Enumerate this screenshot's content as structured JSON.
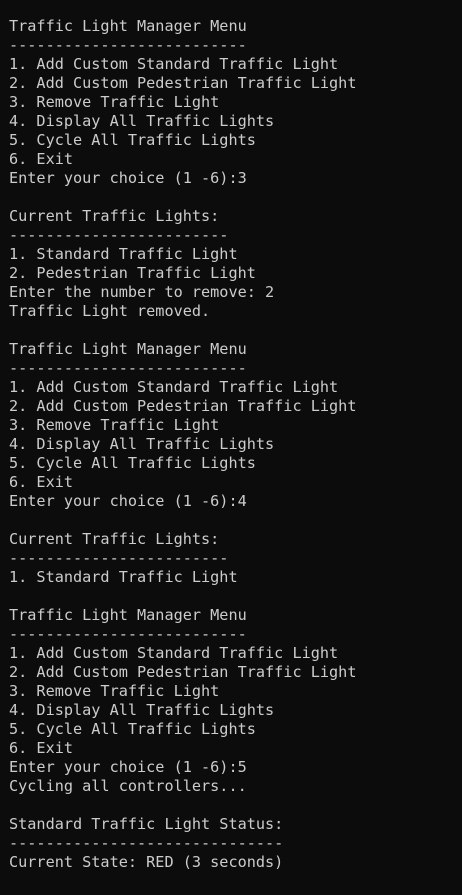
{
  "terminal": {
    "lines": [
      "Traffic Light Manager Menu",
      "--------------------------",
      "1. Add Custom Standard Traffic Light",
      "2. Add Custom Pedestrian Traffic Light",
      "3. Remove Traffic Light",
      "4. Display All Traffic Lights",
      "5. Cycle All Traffic Lights",
      "6. Exit",
      "Enter your choice (1 -6):3",
      "",
      "Current Traffic Lights:",
      "------------------------",
      "1. Standard Traffic Light",
      "2. Pedestrian Traffic Light",
      "Enter the number to remove: 2",
      "Traffic Light removed.",
      "",
      "Traffic Light Manager Menu",
      "--------------------------",
      "1. Add Custom Standard Traffic Light",
      "2. Add Custom Pedestrian Traffic Light",
      "3. Remove Traffic Light",
      "4. Display All Traffic Lights",
      "5. Cycle All Traffic Lights",
      "6. Exit",
      "Enter your choice (1 -6):4",
      "",
      "Current Traffic Lights:",
      "------------------------",
      "1. Standard Traffic Light",
      "",
      "Traffic Light Manager Menu",
      "--------------------------",
      "1. Add Custom Standard Traffic Light",
      "2. Add Custom Pedestrian Traffic Light",
      "3. Remove Traffic Light",
      "4. Display All Traffic Lights",
      "5. Cycle All Traffic Lights",
      "6. Exit",
      "Enter your choice (1 -6):5",
      "Cycling all controllers...",
      "",
      "Standard Traffic Light Status:",
      "------------------------------",
      "Current State: RED (3 seconds)"
    ],
    "colors": {
      "background": "#0c0c0c",
      "text": "#cccccc"
    }
  }
}
